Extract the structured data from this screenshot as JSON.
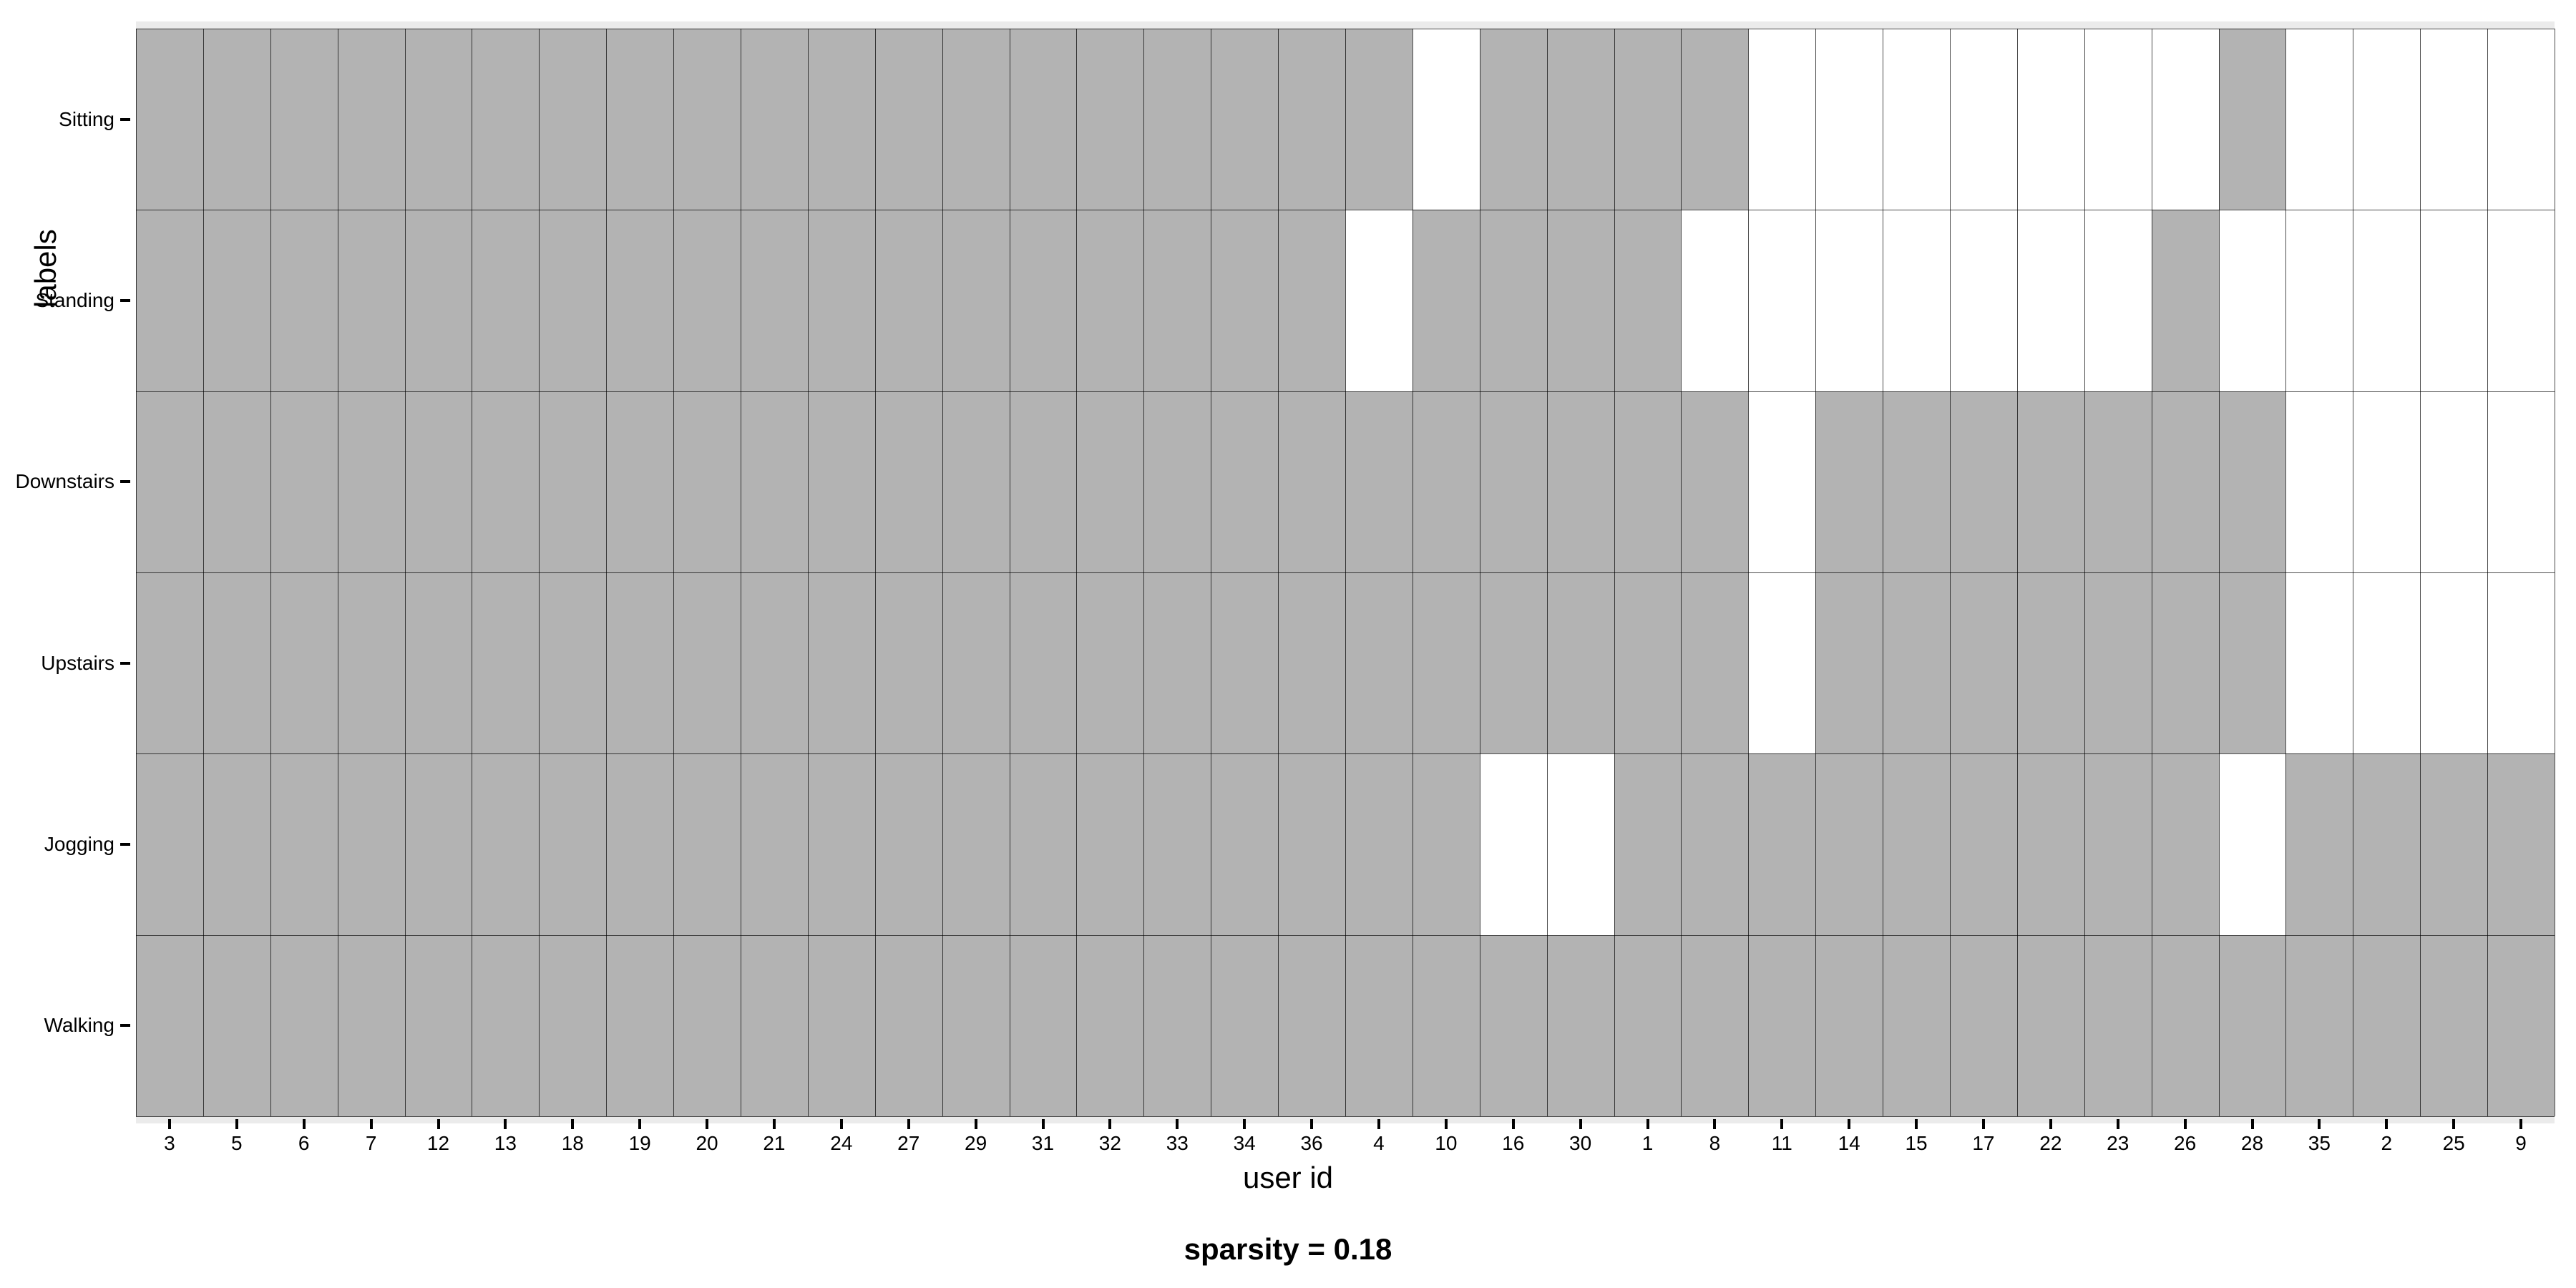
{
  "chart_data": {
    "type": "heatmap",
    "ylabel": "labels",
    "xlabel": "user id",
    "caption": "sparsity = 0.18",
    "y_categories": [
      "Sitting",
      "Standing",
      "Downstairs",
      "Upstairs",
      "Jogging",
      "Walking"
    ],
    "x_categories": [
      "3",
      "5",
      "6",
      "7",
      "12",
      "13",
      "18",
      "19",
      "20",
      "21",
      "24",
      "27",
      "29",
      "31",
      "32",
      "33",
      "34",
      "36",
      "4",
      "10",
      "16",
      "30",
      "1",
      "8",
      "11",
      "14",
      "15",
      "17",
      "22",
      "23",
      "26",
      "28",
      "35",
      "2",
      "25",
      "9"
    ],
    "matrix": [
      [
        1,
        1,
        1,
        1,
        1,
        1,
        1,
        1,
        1,
        1,
        1,
        1,
        1,
        1,
        1,
        1,
        1,
        1,
        1,
        0,
        1,
        1,
        1,
        1,
        0,
        0,
        0,
        0,
        0,
        0,
        0,
        1,
        0,
        0,
        0,
        0
      ],
      [
        1,
        1,
        1,
        1,
        1,
        1,
        1,
        1,
        1,
        1,
        1,
        1,
        1,
        1,
        1,
        1,
        1,
        1,
        0,
        1,
        1,
        1,
        1,
        0,
        0,
        0,
        0,
        0,
        0,
        0,
        1,
        0,
        0,
        0,
        0,
        0
      ],
      [
        1,
        1,
        1,
        1,
        1,
        1,
        1,
        1,
        1,
        1,
        1,
        1,
        1,
        1,
        1,
        1,
        1,
        1,
        1,
        1,
        1,
        1,
        1,
        1,
        0,
        1,
        1,
        1,
        1,
        1,
        1,
        1,
        0,
        0,
        0,
        0
      ],
      [
        1,
        1,
        1,
        1,
        1,
        1,
        1,
        1,
        1,
        1,
        1,
        1,
        1,
        1,
        1,
        1,
        1,
        1,
        1,
        1,
        1,
        1,
        1,
        1,
        0,
        1,
        1,
        1,
        1,
        1,
        1,
        1,
        0,
        0,
        0,
        0
      ],
      [
        1,
        1,
        1,
        1,
        1,
        1,
        1,
        1,
        1,
        1,
        1,
        1,
        1,
        1,
        1,
        1,
        1,
        1,
        1,
        1,
        0,
        0,
        1,
        1,
        1,
        1,
        1,
        1,
        1,
        1,
        1,
        0,
        1,
        1,
        1,
        1
      ],
      [
        1,
        1,
        1,
        1,
        1,
        1,
        1,
        1,
        1,
        1,
        1,
        1,
        1,
        1,
        1,
        1,
        1,
        1,
        1,
        1,
        1,
        1,
        1,
        1,
        1,
        1,
        1,
        1,
        1,
        1,
        1,
        1,
        1,
        1,
        1,
        1
      ]
    ],
    "fill_color": "#b3b3b3",
    "empty_color": "#ffffff",
    "panel_bg": "#ebebeb"
  }
}
